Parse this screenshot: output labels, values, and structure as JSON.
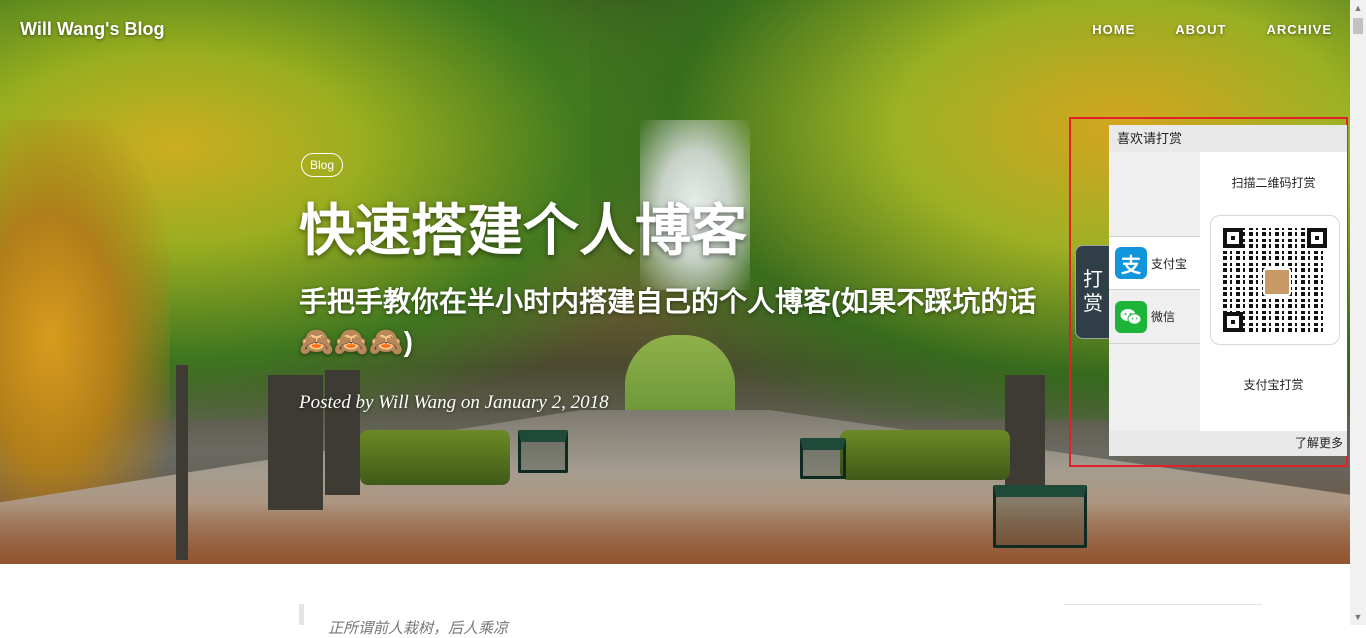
{
  "site": {
    "brand": "Will Wang's Blog"
  },
  "nav": {
    "items": [
      "HOME",
      "ABOUT",
      "ARCHIVE"
    ]
  },
  "post": {
    "tag": "Blog",
    "title": "快速搭建个人博客",
    "subtitle": "手把手教你在半小时内搭建自己的个人博客(如果不踩坑的话🙈🙈🙈)",
    "meta_prefix": "Posted by",
    "author": "Will Wang",
    "meta_on": "on",
    "date": "January 2, 2018"
  },
  "donate": {
    "tab_label_1": "打",
    "tab_label_2": "赏",
    "header": "喜欢请打赏",
    "methods": [
      {
        "label": "支付宝",
        "icon": "alipay-icon"
      },
      {
        "label": "微信",
        "icon": "wechat-icon"
      }
    ],
    "scan_label": "扫描二维码打赏",
    "selected_method_label": "支付宝打赏",
    "footer_link": "了解更多",
    "colors": {
      "alipay": "#1296db",
      "wechat": "#1db43a",
      "tab": "#2f3e47",
      "highlight_border": "#e2202a"
    }
  },
  "content": {
    "quote_preview": "正所谓前人栽树，后人乘凉"
  }
}
